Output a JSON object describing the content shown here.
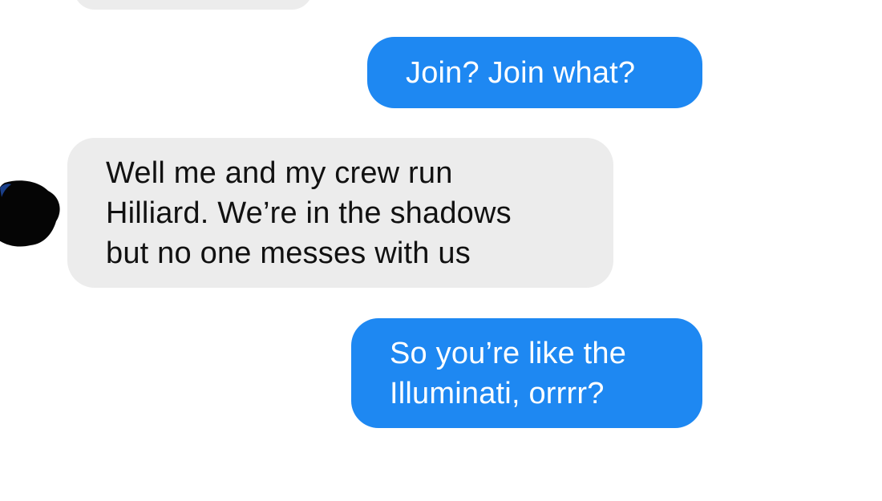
{
  "conversation": {
    "messages": [
      {
        "sender": "them",
        "text": ""
      },
      {
        "sender": "me",
        "text": "Join? Join what?"
      },
      {
        "sender": "them",
        "text": "Well me and my crew run\nHilliard. We’re in the shadows\nbut no one messes with us"
      },
      {
        "sender": "me",
        "text": "So you’re like the\nIlluminati, orrrr?"
      }
    ]
  },
  "colors": {
    "outgoing_bubble": "#1e88f2",
    "incoming_bubble": "#ececec",
    "background": "#ffffff"
  },
  "icons": {
    "avatar": "redacted-avatar-icon"
  }
}
